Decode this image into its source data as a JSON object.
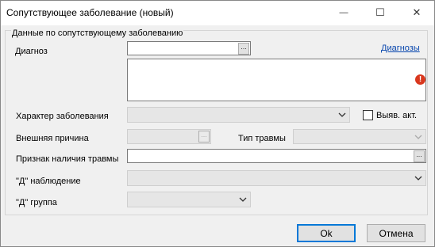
{
  "window": {
    "title": "Сопутствующее заболевание (новый)",
    "minimize_glyph": "—",
    "maximize_glyph": "☐",
    "close_glyph": "✕"
  },
  "group": {
    "legend": "Данные по сопутствующему заболеванию"
  },
  "fields": {
    "diagnosis_label": "Диагноз",
    "diagnosis_value": "",
    "diagnoses_link": "Диагнозы",
    "character_label": "Характер заболевания",
    "character_value": "",
    "detected_checkbox_label": "Выяв. акт.",
    "detected_checked": false,
    "external_cause_label": "Внешняя причина",
    "external_cause_value": "",
    "injury_type_label": "Тип травмы",
    "injury_type_value": "",
    "injury_sign_label": "Признак наличия травмы",
    "injury_sign_value": "",
    "d_observation_label": "\"Д\" наблюдение",
    "d_observation_value": "",
    "d_group_label": "\"Д\" группа",
    "d_group_value": "",
    "ellipsis_glyph": "..."
  },
  "icons": {
    "error": "error-icon",
    "chevron": "chevron-down-icon"
  },
  "buttons": {
    "ok": "Ok",
    "cancel": "Отмена"
  },
  "colors": {
    "link": "#0645ad",
    "error": "#d9381e",
    "focus_border": "#0078d7"
  }
}
